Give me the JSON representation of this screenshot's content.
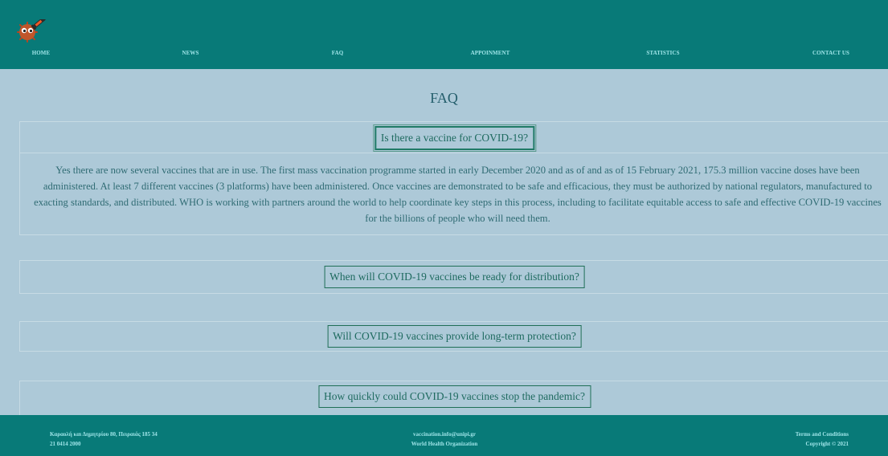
{
  "nav": {
    "items": [
      {
        "label": "HOME"
      },
      {
        "label": "NEWS"
      },
      {
        "label": "FAQ"
      },
      {
        "label": "APPOINMENT"
      },
      {
        "label": "STATISTICS"
      },
      {
        "label": "CONTACT US"
      }
    ]
  },
  "page": {
    "title": "FAQ"
  },
  "faqs": [
    {
      "question": "Is there a vaccine for COVID-19?",
      "answer": "Yes there are now several vaccines that are in use. The first mass vaccination programme started in early December 2020 and as of and as of 15 February 2021, 175.3 million vaccine doses have been administered. At least 7 different vaccines (3 platforms) have been administered. Once vaccines are demonstrated to be safe and efficacious, they must be authorized by national regulators, manufactured to exacting standards, and distributed. WHO is working with partners around the world to help coordinate key steps in this process, including to facilitate equitable access to safe and effective COVID-19 vaccines for the billions of people who will need them."
    },
    {
      "question": "When will COVID-19 vaccines be ready for distribution?"
    },
    {
      "question": "Will COVID-19 vaccines provide long-term protection?"
    },
    {
      "question": "How quickly could COVID-19 vaccines stop the pandemic?"
    }
  ],
  "footer": {
    "address": "Καραολή και Δημητρίου 80, Πειραιάς 185 34",
    "phone": "21 0414 2000",
    "email": "vaccination.info@unipi.gr",
    "org": "World Health Organization",
    "terms": "Terms and Conditions",
    "copyright": "Copyright © 2021"
  },
  "colors": {
    "header_bg": "#087a78",
    "page_bg": "#adc9d8",
    "nav_text": "#9fe5e9",
    "question_text": "#1e6a5f"
  },
  "icons": {
    "logo": "virus-with-syringe-logo"
  }
}
